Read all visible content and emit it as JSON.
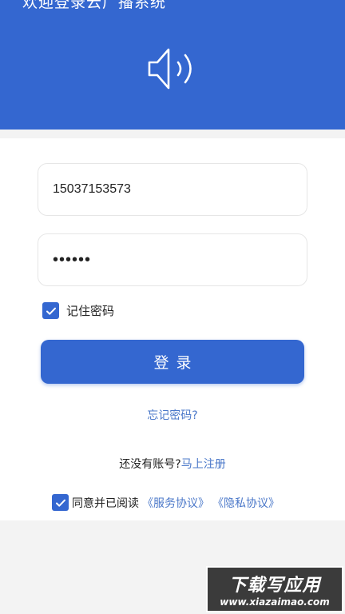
{
  "header": {
    "title": "欢迎登录云广播系统",
    "icon": "speaker-icon",
    "color": "#3467d0"
  },
  "form": {
    "phone_value": "15037153573",
    "password_value": "123456",
    "remember_label": "记住密码",
    "remember_checked": true,
    "login_label": "登录",
    "forgot_label": "忘记密码?"
  },
  "register": {
    "prompt": "还没有账号?",
    "link": "马上注册"
  },
  "agreement": {
    "checked": true,
    "prefix": "同意并已阅读",
    "service": "《服务协议》",
    "privacy": "《隐私协议》"
  },
  "watermark": {
    "main": "下载写应用",
    "sub": "www.xiazaimao.com"
  }
}
